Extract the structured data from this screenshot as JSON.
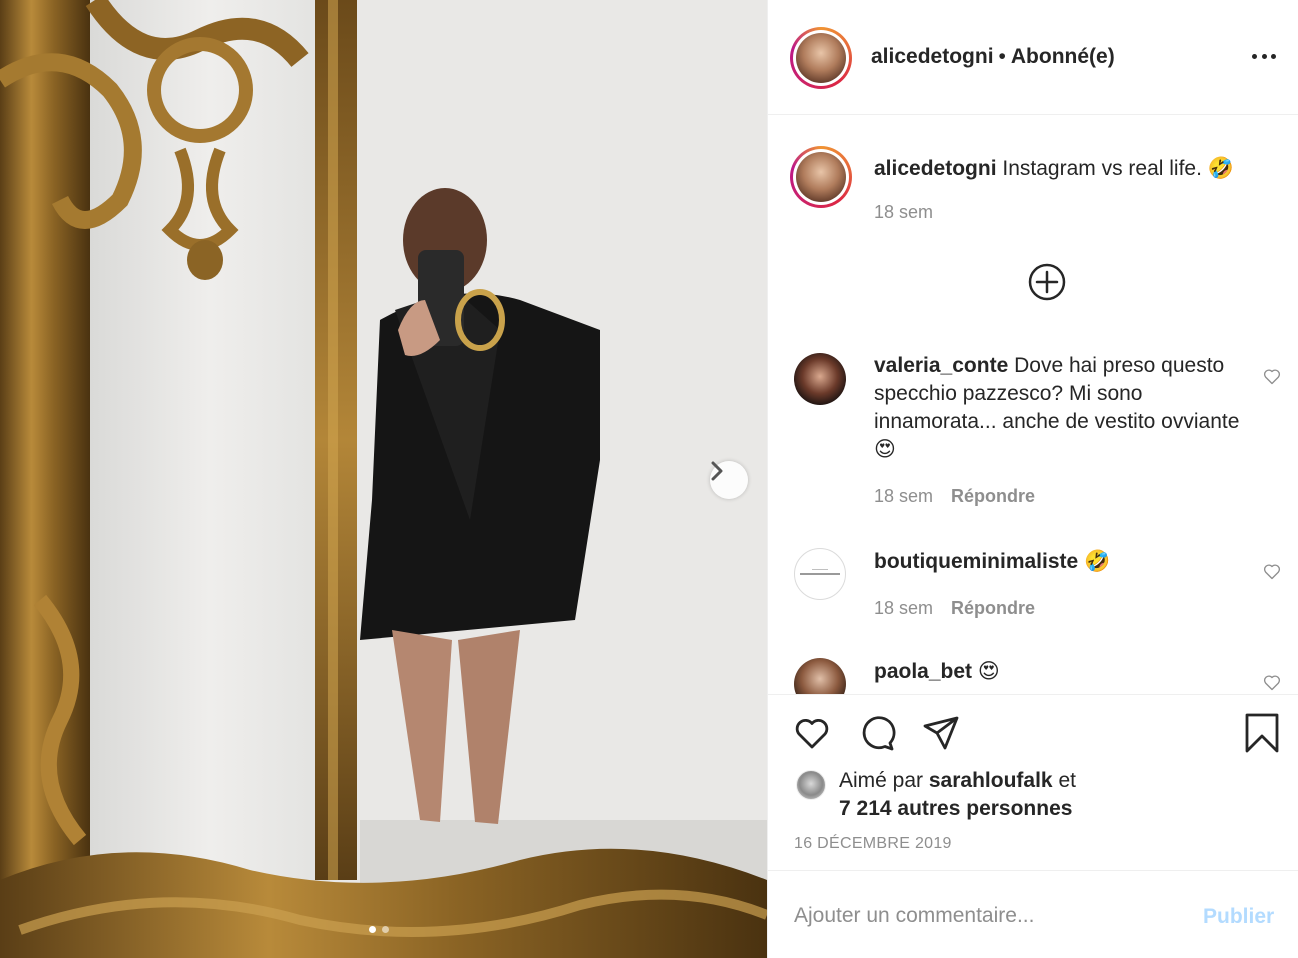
{
  "post": {
    "username": "alicedetogni",
    "separator": "•",
    "follow_status": "Abonné(e)",
    "caption": "Instagram vs real life. 🤣",
    "caption_time": "18 sem"
  },
  "comments": [
    {
      "username": "valeria_conte",
      "text": "Dove hai preso questo specchio pazzesco? Mi sono innamorata... anche de vestito ovviante 😍",
      "time": "18 sem",
      "reply": "Répondre"
    },
    {
      "username": "boutiqueminimaliste",
      "text": "🤣",
      "time": "18 sem",
      "reply": "Répondre"
    },
    {
      "username": "paola_bet",
      "text": "😍"
    }
  ],
  "likes": {
    "prefix": "Aimé par",
    "user": "sarahloufalk",
    "connector": "et",
    "others": "7 214 autres personnes"
  },
  "date": "16 DÉCEMBRE 2019",
  "add_comment": {
    "placeholder": "Ajouter un commentaire...",
    "publish": "Publier"
  },
  "carousel": {
    "current": 1,
    "total": 2
  },
  "icons": [
    "more-icon",
    "plus-circle-icon",
    "heart-icon",
    "comment-icon",
    "share-icon",
    "bookmark-icon",
    "chevron-right-icon"
  ],
  "colors": {
    "publish_disabled": "#b3dbff",
    "meta_gray": "#8e8e8e",
    "text": "#262626"
  }
}
